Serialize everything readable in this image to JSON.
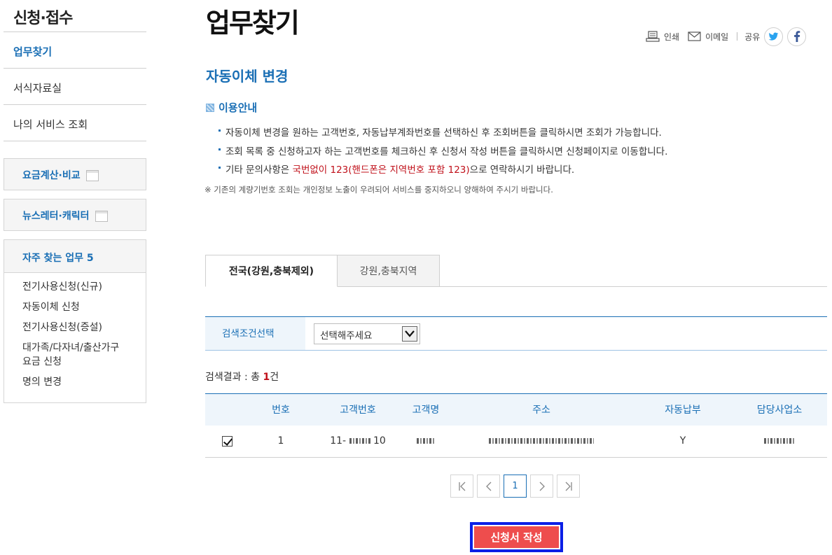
{
  "sidebar": {
    "title": "신청·접수",
    "menu": [
      {
        "label": "업무찾기"
      },
      {
        "label": "서식자료실"
      },
      {
        "label": "나의 서비스 조회"
      }
    ],
    "boxes": [
      {
        "label": "요금계산·비교"
      },
      {
        "label": "뉴스레터·캐릭터"
      }
    ],
    "frequent": {
      "title": "자주 찾는 업무 5",
      "items": [
        {
          "label": "전기사용신청(신규)"
        },
        {
          "label": "자동이체 신청"
        },
        {
          "label": "전기사용신청(증설)"
        },
        {
          "label": "대가족/다자녀/출산가구 요금 신청"
        },
        {
          "label": "명의 변경"
        }
      ]
    }
  },
  "page_title": "업무찾기",
  "utils": {
    "print": "인쇄",
    "email": "이메일",
    "share": "공유"
  },
  "section_title": "자동이체 변경",
  "guide": {
    "title": "이용안내",
    "items": [
      "자동이체 변경을 원하는 고객번호, 자동납부계좌번호를 선택하신 후 조회버튼을 클릭하시면 조회가 가능합니다.",
      "조회 목록 중 신청하고자 하는 고객번호를 체크하신 후 신청서 작성 버튼을 클릭하시면 신청페이지로 이동합니다."
    ],
    "item3_prefix": "기타 문의사항은 ",
    "item3_highlight": "국번없이 123(핸드폰은 지역번호 포함 123)",
    "item3_suffix": "으로 연락하시기 바랍니다.",
    "notice": "※ 기존의 계량기번호 조회는 개인정보 노출이 우려되어 서비스를 중지하오니 양해하여 주시기 바랍니다."
  },
  "tabs": [
    {
      "label": "전국(강원,충북제외)",
      "active": true
    },
    {
      "label": "강원,충북지역",
      "active": false
    }
  ],
  "search": {
    "label": "검색조건선택",
    "select_value": "선택해주세요"
  },
  "result": {
    "prefix": "검색결과 : 총 ",
    "count": "1",
    "suffix": "건"
  },
  "table": {
    "headers": [
      "",
      "번호",
      "고객번호",
      "고객명",
      "주소",
      "자동납부",
      "담당사업소"
    ],
    "rows": [
      {
        "checked": true,
        "no": "1",
        "customer_no_prefix": "11-",
        "customer_no_suffix": "10",
        "auto_pay": "Y"
      }
    ]
  },
  "pagination": {
    "current": "1"
  },
  "submit_label": "신청서 작성"
}
